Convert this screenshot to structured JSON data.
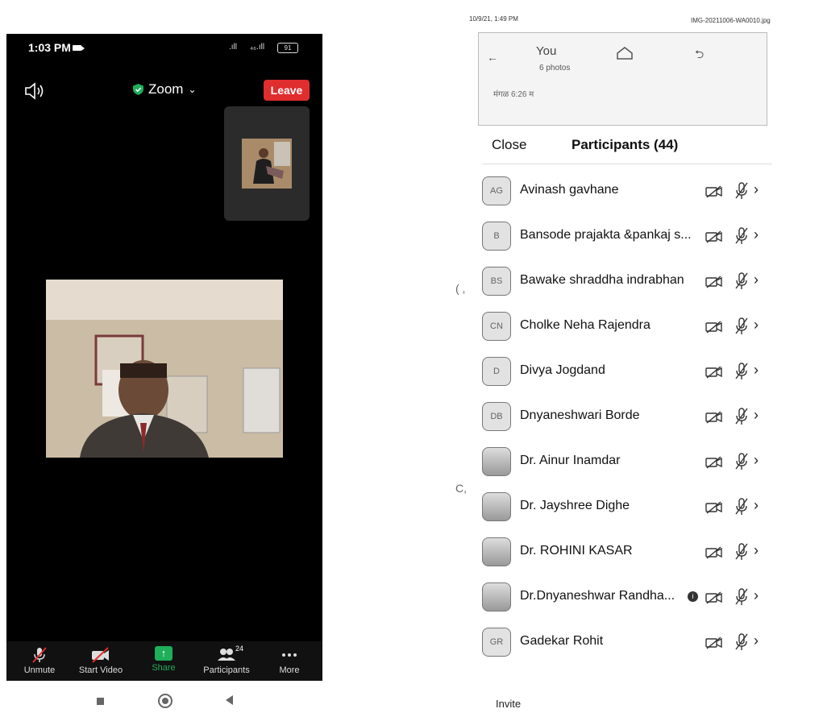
{
  "phone": {
    "status": {
      "time": "1:03 PM",
      "signal_left": ".ıll",
      "signal_right": "₄₆.ıll",
      "battery": "91"
    },
    "topbar": {
      "title": "Zoom",
      "leave": "Leave"
    },
    "toolbar": {
      "unmute": "Unmute",
      "start_video": "Start Video",
      "share": "Share",
      "participants": "Participants",
      "participants_count": "24",
      "more": "More"
    }
  },
  "scan": {
    "date": "10/9/21, 1:49 PM",
    "filename": "IMG-20211006-WA0010.jpg",
    "you": "You",
    "photos": "6 photos",
    "photo_time": "मंगळ 6:26 म",
    "close": "Close",
    "title": "Participants (44)",
    "invite": "Invite",
    "participants": [
      {
        "initials": "AG",
        "name": "Avinash gavhane"
      },
      {
        "initials": "B",
        "name": "Bansode prajakta &pankaj s..."
      },
      {
        "initials": "BS",
        "name": "Bawake shraddha indrabhan"
      },
      {
        "initials": "CN",
        "name": "Cholke Neha Rajendra"
      },
      {
        "initials": "D",
        "name": "Divya Jogdand"
      },
      {
        "initials": "DB",
        "name": "Dnyaneshwari Borde"
      },
      {
        "initials": "",
        "name": "Dr. Ainur Inamdar"
      },
      {
        "initials": "",
        "name": "Dr. Jayshree Dighe"
      },
      {
        "initials": "",
        "name": "Dr. ROHINI KASAR"
      },
      {
        "initials": "",
        "name": "Dr.Dnyaneshwar Randha..."
      },
      {
        "initials": "GR",
        "name": "Gadekar Rohit"
      }
    ]
  },
  "colors": {
    "leave": "#e02d2d",
    "share": "#1fae59",
    "shield": "#1fae59"
  }
}
